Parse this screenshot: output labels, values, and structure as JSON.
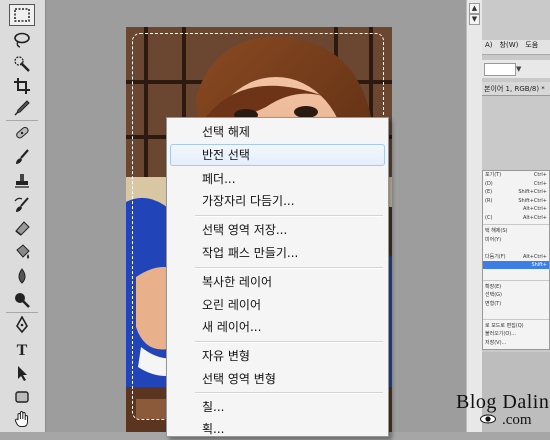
{
  "toolbar": {
    "tools": [
      {
        "name": "rectangular-marquee-tool",
        "icon": "marquee-icon",
        "selected": true
      },
      {
        "name": "lasso-tool",
        "icon": "lasso-icon"
      },
      {
        "name": "quick-selection-tool",
        "icon": "quick-selection-icon"
      },
      {
        "name": "crop-tool",
        "icon": "crop-icon"
      },
      {
        "name": "eyedropper-tool",
        "icon": "eyedropper-icon"
      },
      {
        "name": "healing-brush-tool",
        "icon": "bandage-icon"
      },
      {
        "name": "brush-tool",
        "icon": "brush-icon"
      },
      {
        "name": "clone-stamp-tool",
        "icon": "stamp-icon"
      },
      {
        "name": "history-brush-tool",
        "icon": "history-brush-icon"
      },
      {
        "name": "eraser-tool",
        "icon": "eraser-icon"
      },
      {
        "name": "paint-bucket-tool",
        "icon": "bucket-icon"
      },
      {
        "name": "blur-tool",
        "icon": "drop-icon"
      },
      {
        "name": "dodge-tool",
        "icon": "dodge-icon"
      },
      {
        "name": "pen-tool",
        "icon": "pen-icon"
      },
      {
        "name": "type-tool",
        "icon": "type-icon",
        "glyph": "T"
      },
      {
        "name": "path-selection-tool",
        "icon": "arrow-pointer-icon"
      },
      {
        "name": "shape-tool",
        "icon": "rectangle-shape-icon"
      },
      {
        "name": "hand-tool",
        "icon": "hand-icon"
      }
    ]
  },
  "context_menu": {
    "items": [
      {
        "label": "선택 해제"
      },
      {
        "label": "반전 선택",
        "highlighted": true
      },
      {
        "label": "페더..."
      },
      {
        "label": "가장자리 다듬기..."
      },
      {
        "label": "선택 영역 저장..."
      },
      {
        "label": "작업 패스 만들기..."
      },
      {
        "label": "복사한 레이어"
      },
      {
        "label": "오린 레이어"
      },
      {
        "label": "새 레이어..."
      },
      {
        "label": "자유 변형"
      },
      {
        "label": "선택 영역 변형"
      },
      {
        "label": "칠..."
      },
      {
        "label": "획..."
      }
    ]
  },
  "right_panel": {
    "menubar": [
      "A)",
      "창(W)",
      "도움"
    ],
    "document_tab": "본이어 1, RGB/8) *",
    "menu_items": [
      {
        "label": "포기(T)",
        "shortcut": "Ctrl+"
      },
      {
        "label": "(D)",
        "shortcut": "Ctrl+"
      },
      {
        "label": "(E)",
        "shortcut": "Shift+Ctrl+"
      },
      {
        "label": "(R)",
        "shortcut": "Shift+Ctrl+"
      },
      {
        "label": "",
        "shortcut": "Alt+Ctrl+"
      },
      {
        "label": "(C)",
        "shortcut": "Alt+Ctrl+"
      },
      {
        "label": "택 해제(S)",
        "shortcut": ""
      },
      {
        "label": "미어(Y)",
        "shortcut": ""
      },
      {
        "label": "",
        "shortcut": ""
      },
      {
        "label": "다듬기(F)",
        "shortcut": "Alt+Ctrl+"
      },
      {
        "label": "",
        "shortcut": "Shift+"
      },
      {
        "label": "",
        "shortcut": ""
      },
      {
        "label": "확장(E)",
        "shortcut": ""
      },
      {
        "label": "선택(G)",
        "shortcut": ""
      },
      {
        "label": "변형(T)",
        "shortcut": ""
      },
      {
        "label": "",
        "shortcut": ""
      },
      {
        "label": "로 모드로 편집(Q)",
        "shortcut": ""
      },
      {
        "label": "불러오기(O)...",
        "shortcut": ""
      },
      {
        "label": "저장(V)...",
        "shortcut": ""
      }
    ]
  },
  "watermark": {
    "title": "Blog Dalin",
    "subtitle": ".com"
  }
}
